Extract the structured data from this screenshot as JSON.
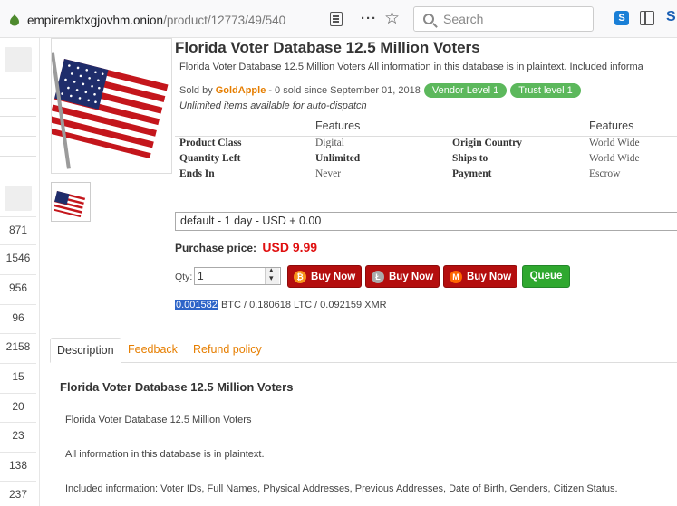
{
  "browser": {
    "url_host": "empiremktxgjovhm.onion",
    "url_path": "/product/12773/49/540",
    "search_placeholder": "Search"
  },
  "sidebar": {
    "numbers": [
      "871",
      "1546",
      "956",
      "96",
      "2158",
      "15",
      "20",
      "23",
      "138",
      "237"
    ]
  },
  "product": {
    "title": "Florida Voter Database 12.5 Million Voters",
    "short_desc": "Florida Voter Database 12.5 Million Voters All information in this database is in plaintext. Included informa",
    "sold_by_prefix": "Sold by",
    "seller": "GoldApple",
    "sold_suffix": "- 0 sold since September 01, 2018",
    "vendor_level": "Vendor Level 1",
    "trust_level": "Trust level 1",
    "dispatch": "Unlimited items available for auto-dispatch"
  },
  "features": {
    "header_left": "Features",
    "header_right": "Features",
    "rows": [
      {
        "l1": "Product Class",
        "v1": "Digital",
        "l2": "Origin Country",
        "v2": "World Wide"
      },
      {
        "l1": "Quantity Left",
        "v1": "Unlimited",
        "l2": "Ships to",
        "v2": "World Wide"
      },
      {
        "l1": "Ends In",
        "v1": "Never",
        "l2": "Payment",
        "v2": "Escrow"
      }
    ]
  },
  "purchase": {
    "option": "default - 1 day - USD + 0.00",
    "price_label": "Purchase price:",
    "price": "USD 9.99",
    "qty_label": "Qty:",
    "qty_value": "1",
    "buy_label": "Buy Now",
    "queue_label": "Queue",
    "btc_amount": "0.001582",
    "crypto_rest": " BTC / 0.180618 LTC / 0.092159 XMR"
  },
  "tabs": [
    "Description",
    "Feedback",
    "Refund policy"
  ],
  "description": {
    "title": "Florida Voter Database 12.5 Million Voters",
    "lines": [
      "Florida Voter Database 12.5 Million Voters",
      "All information in this database is in plaintext.",
      "Included information: Voter IDs, Full Names, Physical Addresses, Previous Addresses, Date of Birth, Genders,  Citizen Status."
    ]
  },
  "colors": {
    "seller_orange": "#e67e00",
    "pill_green": "#5cb85c",
    "buy_red": "#b40e0e",
    "queue_green": "#2fa82f",
    "price_red": "#e01010",
    "selection_blue": "#2d64c8"
  }
}
